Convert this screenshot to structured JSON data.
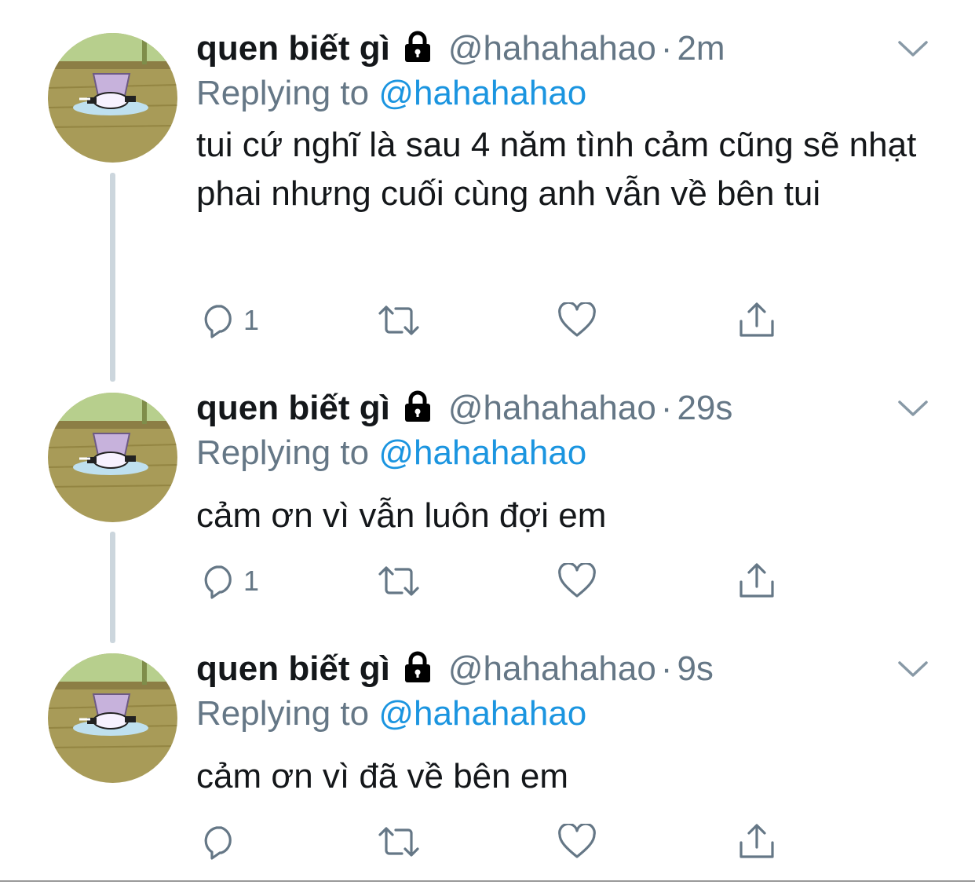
{
  "tweets": [
    {
      "name": "quen biết gì",
      "handle": "@hahahahao",
      "dot": "·",
      "time": "2m",
      "replying_prefix": "Replying to ",
      "replying_to": "@hahahahao",
      "text": "tui cứ nghĩ là sau 4 năm tình cảm cũng sẽ nhạt phai nhưng cuối cùng anh vẫn về bên tui",
      "reply_count": "1",
      "retweet_count": "",
      "like_count": ""
    },
    {
      "name": "quen biết gì",
      "handle": "@hahahahao",
      "dot": "·",
      "time": "29s",
      "replying_prefix": "Replying to ",
      "replying_to": "@hahahahao",
      "text": "cảm ơn vì vẫn luôn đợi em",
      "reply_count": "1",
      "retweet_count": "",
      "like_count": ""
    },
    {
      "name": "quen biết gì",
      "handle": "@hahahahao",
      "dot": "·",
      "time": "9s",
      "replying_prefix": "Replying to ",
      "replying_to": "@hahahahao",
      "text": "cảm ơn vì đã về bên em",
      "reply_count": "",
      "retweet_count": "",
      "like_count": ""
    }
  ],
  "icons": {
    "lock": "lock-icon",
    "caret": "chevron-down-icon",
    "reply": "reply-icon",
    "retweet": "retweet-icon",
    "like": "heart-icon",
    "share": "share-icon"
  },
  "colors": {
    "text": "#14171a",
    "secondary": "#657786",
    "link": "#1b95e0",
    "thread_line": "#ccd6dd"
  }
}
